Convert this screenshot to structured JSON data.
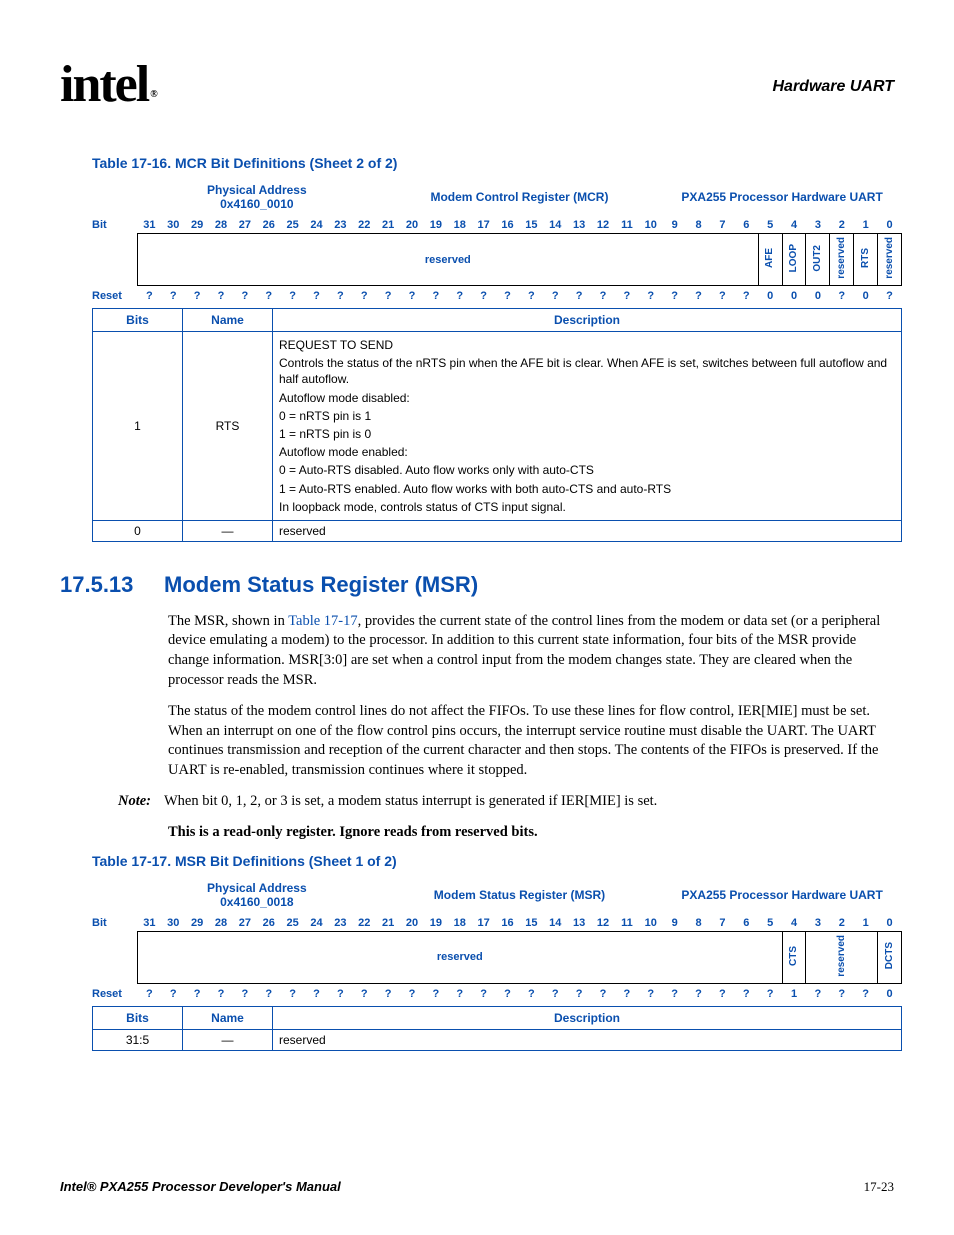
{
  "header": {
    "logo": "intel",
    "right": "Hardware UART"
  },
  "table1": {
    "caption": "Table 17-16. MCR Bit Definitions (Sheet 2 of 2)",
    "phys_label": "Physical Address",
    "phys_addr": "0x4160_0010",
    "reg_name": "Modem Control Register (MCR)",
    "chip": "PXA255 Processor Hardware UART",
    "bit_label": "Bit",
    "bits": [
      "31",
      "30",
      "29",
      "28",
      "27",
      "26",
      "25",
      "24",
      "23",
      "22",
      "21",
      "20",
      "19",
      "18",
      "17",
      "16",
      "15",
      "14",
      "13",
      "12",
      "11",
      "10",
      "9",
      "8",
      "7",
      "6",
      "5",
      "4",
      "3",
      "2",
      "1",
      "0"
    ],
    "fields": {
      "reserved": "reserved",
      "afe": "AFE",
      "loop": "LOOP",
      "out2": "OUT2",
      "resv2": "reserved",
      "rts": "RTS",
      "resv3": "reserved"
    },
    "reset_label": "Reset",
    "reset": [
      "?",
      "?",
      "?",
      "?",
      "?",
      "?",
      "?",
      "?",
      "?",
      "?",
      "?",
      "?",
      "?",
      "?",
      "?",
      "?",
      "?",
      "?",
      "?",
      "?",
      "?",
      "?",
      "?",
      "?",
      "?",
      "?",
      "0",
      "0",
      "0",
      "?",
      "0",
      "?"
    ],
    "desc_hdr": {
      "bits": "Bits",
      "name": "Name",
      "desc": "Description"
    },
    "rows": [
      {
        "bits": "1",
        "name": "RTS",
        "desc": {
          "l0": "REQUEST TO SEND",
          "l1": "Controls the status of the nRTS pin when the AFE bit is clear. When AFE is set, switches between full autoflow and half autoflow.",
          "l2": "Autoflow mode disabled:",
          "l3": "0 =  nRTS pin is 1",
          "l4": "1 =  nRTS pin is 0",
          "l5": "Autoflow mode enabled:",
          "l6": "0 =  Auto-RTS disabled. Auto flow works only with auto-CTS",
          "l7": "1 =  Auto-RTS enabled. Auto flow works with both auto-CTS and auto-RTS",
          "l8": "In loopback mode, controls status of CTS input signal."
        }
      },
      {
        "bits": "0",
        "name": "—",
        "desc": "reserved"
      }
    ]
  },
  "section": {
    "num": "17.5.13",
    "title": "Modem Status Register (MSR)",
    "p1a": "The MSR, shown in ",
    "p1link": "Table 17-17",
    "p1b": ", provides the current state of the control lines from the modem or data set (or a peripheral device emulating a modem) to the processor. In addition to this current state information, four bits of the MSR provide change information. MSR[3:0] are set when a control input from the modem changes state. They are cleared when the processor reads the MSR.",
    "p2": "The status of the modem control lines do not affect the FIFOs. To use these lines for flow control, IER[MIE] must be set. When an interrupt on one of the flow control pins occurs, the interrupt service routine must disable the UART. The UART continues transmission and reception of the current character and then stops. The contents of the FIFOs is preserved. If the UART is re-enabled, transmission continues where it stopped.",
    "note_label": "Note:",
    "note": "When bit 0, 1, 2, or 3 is set, a modem status interrupt is generated if IER[MIE] is set.",
    "bold": "This is a read-only register. Ignore reads from reserved bits."
  },
  "table2": {
    "caption": "Table 17-17. MSR Bit Definitions (Sheet 1 of 2)",
    "phys_label": "Physical Address",
    "phys_addr": "0x4160_0018",
    "reg_name": "Modem Status Register (MSR)",
    "chip": "PXA255 Processor Hardware UART",
    "bit_label": "Bit",
    "bits": [
      "31",
      "30",
      "29",
      "28",
      "27",
      "26",
      "25",
      "24",
      "23",
      "22",
      "21",
      "20",
      "19",
      "18",
      "17",
      "16",
      "15",
      "14",
      "13",
      "12",
      "11",
      "10",
      "9",
      "8",
      "7",
      "6",
      "5",
      "4",
      "3",
      "2",
      "1",
      "0"
    ],
    "fields": {
      "reserved": "reserved",
      "cts": "CTS",
      "resv2": "reserved",
      "dcts": "DCTS"
    },
    "reset_label": "Reset",
    "reset": [
      "?",
      "?",
      "?",
      "?",
      "?",
      "?",
      "?",
      "?",
      "?",
      "?",
      "?",
      "?",
      "?",
      "?",
      "?",
      "?",
      "?",
      "?",
      "?",
      "?",
      "?",
      "?",
      "?",
      "?",
      "?",
      "?",
      "?",
      "1",
      "?",
      "?",
      "?",
      "0"
    ],
    "desc_hdr": {
      "bits": "Bits",
      "name": "Name",
      "desc": "Description"
    },
    "rows": [
      {
        "bits": "31:5",
        "name": "—",
        "desc": "reserved"
      }
    ]
  },
  "footer": {
    "left": "Intel® PXA255 Processor Developer's Manual",
    "right": "17-23"
  }
}
